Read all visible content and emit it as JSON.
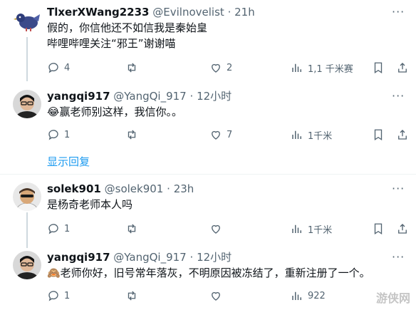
{
  "tweets": [
    {
      "name": "TlxerXWang2233",
      "handle": "@Evilnovelist",
      "time": "21h",
      "lines": [
        "假的，你信他还不如信我是秦始皇",
        "哔哩哔哩关注“邪王”谢谢喵"
      ],
      "replies": "4",
      "retweets": "",
      "likes": "2",
      "views": "1,1 千米赛"
    },
    {
      "name": "yangqi917",
      "handle": "@YangQi_917",
      "time": "12小时",
      "lines": [
        "😂赢老师别这样，我信你。。"
      ],
      "replies": "1",
      "retweets": "",
      "likes": "7",
      "views": "1千米"
    },
    {
      "name": "solek901",
      "handle": "@solek901",
      "time": "23h",
      "lines": [
        "是杨奇老师本人吗"
      ],
      "replies": "1",
      "retweets": "",
      "likes": "",
      "views": "1千米"
    },
    {
      "name": "yangqi917",
      "handle": "@YangQi_917",
      "time": "12小时",
      "lines": [
        "🙈老师你好，旧号常年落灰，不明原因被冻结了，重新注册了一个。"
      ],
      "replies": "1",
      "retweets": "",
      "likes": "",
      "views": "922"
    }
  ],
  "show_replies": "显示回复",
  "watermark": "游侠网",
  "separator": "·",
  "more_label": "···",
  "colors": {
    "accent": "#1d9bf0",
    "secondary_text": "#536471",
    "thread_line": "#cfd9de"
  }
}
